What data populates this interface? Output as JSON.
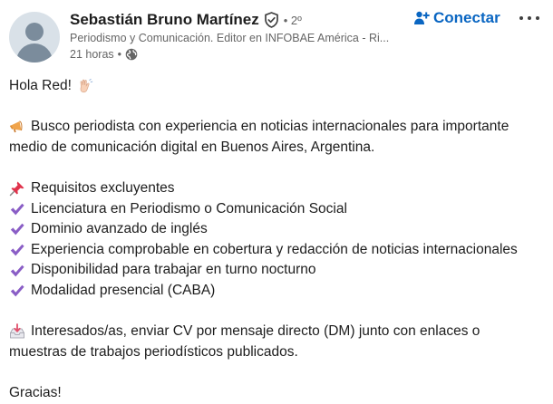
{
  "author": {
    "name": "Sebastián Bruno Martínez",
    "degree": "• 2º",
    "headline": "Periodismo y Comunicación. Editor en INFOBAE América - Ri...",
    "time": "21 horas",
    "dot": "•"
  },
  "actions": {
    "connect_label": "Conectar"
  },
  "post": {
    "greeting": "Hola Red!",
    "intro_line1": "Busco periodista con experiencia en noticias internacionales para importante",
    "intro_line2": "medio de comunicación digital en Buenos Aires, Argentina.",
    "requirements_title": "Requisitos excluyentes",
    "requirements": [
      "Licenciatura en Periodismo o Comunicación Social",
      "Dominio avanzado de inglés",
      "Experiencia comprobable en cobertura y redacción de noticias internacionales",
      "Disponibilidad para trabajar en turno nocturno",
      "Modalidad presencial (CABA)"
    ],
    "cta_line1": "Interesados/as, enviar CV por mensaje directo (DM) junto con enlaces o",
    "cta_line2": "muestras de trabajos periodísticos publicados.",
    "closing": "Gracias!"
  },
  "icons": {
    "verified": "verified-shield-icon",
    "globe": "globe-icon",
    "connect": "add-person-icon",
    "more": "more-options-icon",
    "wave": "waving-hand-emoji",
    "megaphone": "megaphone-emoji",
    "pin": "pushpin-emoji",
    "check": "check-mark-emoji",
    "inbox": "inbox-tray-emoji"
  },
  "colors": {
    "link_blue": "#0a66c2",
    "secondary_text": "#666666",
    "check_purple": "#8a5ec6"
  }
}
